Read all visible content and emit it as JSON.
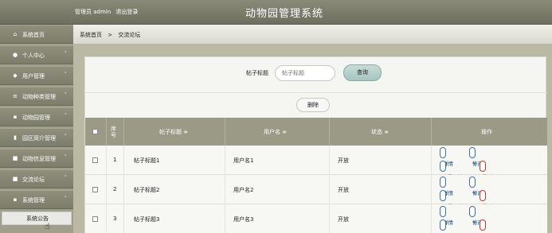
{
  "header": {
    "admin_label": "管理员 admin",
    "logout": "退出登录",
    "system_title": "动物园管理系统"
  },
  "sidebar": {
    "items": [
      {
        "icon": "home-icon",
        "glyph": "⌂",
        "label": "系统首页",
        "chevron": ""
      },
      {
        "icon": "user-icon",
        "glyph": "●",
        "label": "个人中心",
        "chevron": "˅"
      },
      {
        "icon": "shield-icon",
        "glyph": "◆",
        "label": "用户管理",
        "chevron": "˅"
      },
      {
        "icon": "list-icon",
        "glyph": "≡",
        "label": "动物种类管理",
        "chevron": "˅"
      },
      {
        "icon": "grid-icon",
        "glyph": "▪",
        "label": "动物园管理",
        "chevron": "˅"
      },
      {
        "icon": "bar-chart-icon",
        "glyph": "▮",
        "label": "园区简介管理",
        "chevron": "˅"
      },
      {
        "icon": "message-icon",
        "glyph": "■",
        "label": "动物信息管理",
        "chevron": "˅"
      },
      {
        "icon": "forum-icon",
        "glyph": "■",
        "label": "交流论坛",
        "chevron": "˅"
      },
      {
        "icon": "grid-icon",
        "glyph": "▪",
        "label": "系统管理",
        "chevron": "˄"
      }
    ],
    "sub_item": "系统公告"
  },
  "breadcrumb": {
    "home": "系统首页",
    "separator": ">",
    "current": "交流论坛"
  },
  "search": {
    "label": "帖子标题",
    "placeholder": "帖子标题",
    "button": "查询"
  },
  "toolbar": {
    "delete_label": "删除"
  },
  "table": {
    "headers": {
      "index": "序号",
      "title": "帖子标题 ≑",
      "username": "用户名 ≑",
      "status": "状态 ≑",
      "actions": "操作"
    },
    "rows": [
      {
        "index": "1",
        "title": "帖子标题1",
        "username": "用户名1",
        "status": "开放"
      },
      {
        "index": "2",
        "title": "帖子标题2",
        "username": "用户名2",
        "status": "开放"
      },
      {
        "index": "3",
        "title": "帖子标题3",
        "username": "用户名3",
        "status": "开放"
      }
    ],
    "actions": {
      "detail": "详情",
      "edit": "修改",
      "view_comments": "查看评论",
      "delete": "删除"
    }
  },
  "colors": {
    "header": "#7d7d6b",
    "sidebar": "#8f8f7c",
    "table_header": "#9a9a87",
    "accent_blue": "#3a6fa8",
    "danger": "#c0392b"
  }
}
